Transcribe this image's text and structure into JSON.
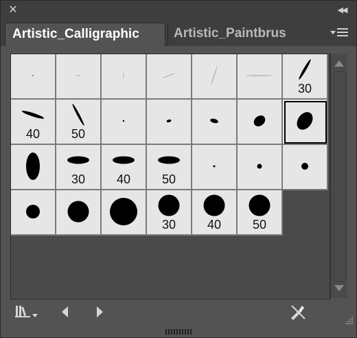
{
  "panel": {
    "tabs": [
      {
        "label": "Artistic_Calligraphic",
        "active": true
      },
      {
        "label": "Artistic_Paintbrus",
        "active": false
      }
    ]
  },
  "brushes": [
    {
      "shape": "dot",
      "w": 1.5,
      "h": 1,
      "angle": 0,
      "label": ""
    },
    {
      "shape": "ellipse",
      "w": 6,
      "h": 0.8,
      "angle": -15,
      "label": ""
    },
    {
      "shape": "ellipse",
      "w": 10,
      "h": 0.8,
      "angle": -90,
      "label": ""
    },
    {
      "shape": "ellipse",
      "w": 20,
      "h": 0.9,
      "angle": -22,
      "label": ""
    },
    {
      "shape": "ellipse",
      "w": 30,
      "h": 1,
      "angle": -72,
      "label": ""
    },
    {
      "shape": "ellipse",
      "w": 40,
      "h": 1,
      "angle": 0,
      "label": ""
    },
    {
      "shape": "ellipse",
      "w": 34,
      "h": 4,
      "angle": -60,
      "label": "30"
    },
    {
      "shape": "ellipse",
      "w": 34,
      "h": 5,
      "angle": 18,
      "label": "40"
    },
    {
      "shape": "ellipse",
      "w": 36,
      "h": 3.5,
      "angle": 62,
      "label": "50"
    },
    {
      "shape": "dot",
      "w": 2.5,
      "h": 2.5,
      "angle": 0,
      "label": ""
    },
    {
      "shape": "ellipse",
      "w": 7,
      "h": 4,
      "angle": -15,
      "label": ""
    },
    {
      "shape": "ellipse",
      "w": 12,
      "h": 6,
      "angle": 15,
      "label": ""
    },
    {
      "shape": "ellipse",
      "w": 18,
      "h": 14,
      "angle": -40,
      "label": ""
    },
    {
      "shape": "ellipse",
      "w": 28,
      "h": 20,
      "angle": -55,
      "label": ""
    },
    {
      "shape": "ellipse",
      "w": 20,
      "h": 40,
      "angle": 0,
      "label": ""
    },
    {
      "shape": "ellipse",
      "w": 32,
      "h": 11,
      "angle": 0,
      "label": "30"
    },
    {
      "shape": "ellipse",
      "w": 32,
      "h": 11,
      "angle": 0,
      "label": "40"
    },
    {
      "shape": "ellipse",
      "w": 32,
      "h": 11,
      "angle": 0,
      "label": "50"
    },
    {
      "shape": "dot",
      "w": 3,
      "h": 3,
      "angle": 0,
      "label": ""
    },
    {
      "shape": "dot",
      "w": 7,
      "h": 7,
      "angle": 0,
      "label": ""
    },
    {
      "shape": "dot",
      "w": 10,
      "h": 10,
      "angle": 0,
      "label": ""
    },
    {
      "shape": "dot",
      "w": 20,
      "h": 20,
      "angle": 0,
      "label": ""
    },
    {
      "shape": "dot",
      "w": 31,
      "h": 31,
      "angle": 0,
      "label": ""
    },
    {
      "shape": "dot",
      "w": 40,
      "h": 40,
      "angle": 0,
      "label": ""
    },
    {
      "shape": "dot",
      "w": 31,
      "h": 31,
      "angle": 0,
      "label": "30"
    },
    {
      "shape": "dot",
      "w": 31,
      "h": 31,
      "angle": 0,
      "label": "40"
    },
    {
      "shape": "dot",
      "w": 31,
      "h": 31,
      "angle": 0,
      "label": "50"
    }
  ],
  "selected_index": 13,
  "toolbar": {
    "buttons": [
      "brush-libraries-menu-icon",
      "previous-library-icon",
      "next-library-icon",
      "remove-brush-icon"
    ]
  },
  "colors": {
    "panel_bg": "#535353",
    "cell_bg": "#e6e6e6",
    "active_tab_text": "#ffffff",
    "inactive_tab_text": "#b9b9b9"
  }
}
